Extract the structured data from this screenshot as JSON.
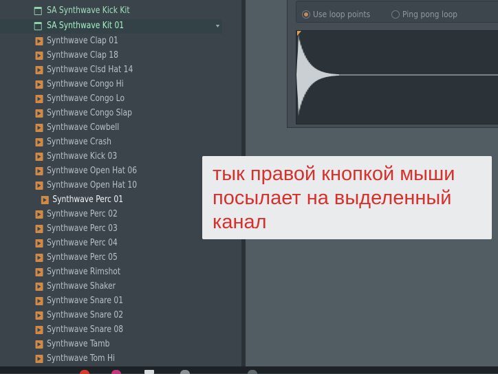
{
  "browser": {
    "folders": [
      {
        "label": "SA Synthwave Kick Kit"
      },
      {
        "label": "SA Synthwave Kit 01"
      }
    ],
    "samples": [
      {
        "label": "Synthwave Clap 01"
      },
      {
        "label": "Synthwave Clap 18"
      },
      {
        "label": "Synthwave Clsd Hat 14"
      },
      {
        "label": "Synthwave Congo Hi"
      },
      {
        "label": "Synthwave Congo Lo"
      },
      {
        "label": "Synthwave Congo Slap"
      },
      {
        "label": "Synthwave Cowbell"
      },
      {
        "label": "Synthwave Crash"
      },
      {
        "label": "Synthwave Kick 03"
      },
      {
        "label": "Synthwave Open Hat 06"
      },
      {
        "label": "Synthwave Open Hat 10"
      },
      {
        "label": "Synthwave Perc 01"
      },
      {
        "label": "Synthwave Perc 02"
      },
      {
        "label": "Synthwave Perc 03"
      },
      {
        "label": "Synthwave Perc 04"
      },
      {
        "label": "Synthwave Perc 05"
      },
      {
        "label": "Synthwave Rimshot"
      },
      {
        "label": "Synthwave Shaker"
      },
      {
        "label": "Synthwave Snare 01"
      },
      {
        "label": "Synthwave Snare 02"
      },
      {
        "label": "Synthwave Snare 08"
      },
      {
        "label": "Synthwave Tamb"
      },
      {
        "label": "Synthwave Tom Hi"
      }
    ],
    "selected_sample": "Synthwave Perc 01"
  },
  "sampler": {
    "use_loop_points": "Use loop points",
    "ping_pong_loop": "Ping pong loop",
    "use_loop_points_checked": true,
    "ping_pong_loop_checked": false
  },
  "annotation": {
    "lines": [
      "тык правой кнопкой мыши",
      "посылает на выделенный",
      "канал"
    ],
    "color": "#d7312d"
  },
  "colors": {
    "panel": "#3b444a",
    "folder_text": "#9fe0bc",
    "sample_icon": "#d08a48",
    "waveform": "#c9cfd2"
  }
}
